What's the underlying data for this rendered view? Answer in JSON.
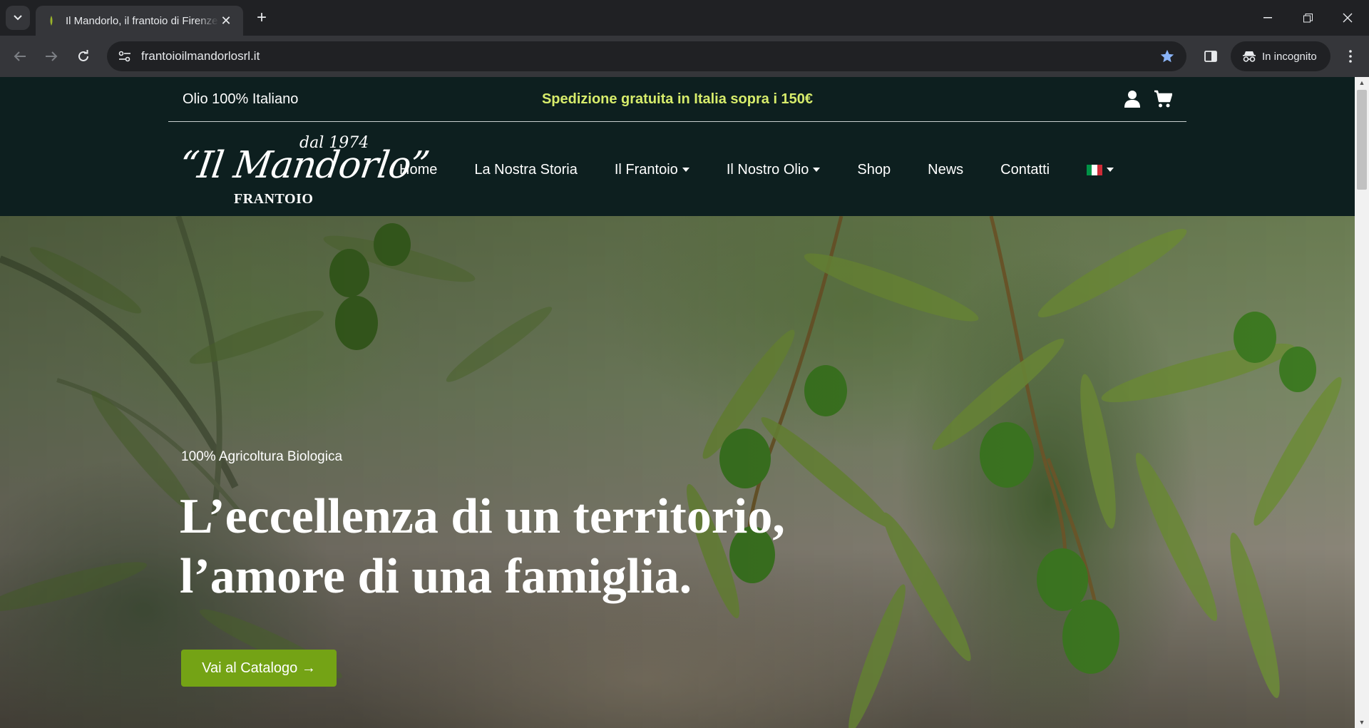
{
  "browser": {
    "tab_title": "Il Mandorlo, il frantoio di Firenze",
    "url": "frantoioilmandorlosrl.it",
    "incognito_label": "In incognito"
  },
  "topbar": {
    "left_text": "Olio 100% Italiano",
    "center_text": "Spedizione gratuita in Italia sopra i 150€"
  },
  "logo": {
    "script_text": "“Il Mandorlo”",
    "year_text": "dal 1974",
    "sub_text": "FRANTOIO"
  },
  "nav": {
    "items": [
      {
        "label": "Home",
        "dropdown": false
      },
      {
        "label": "La Nostra Storia",
        "dropdown": false
      },
      {
        "label": "Il Frantoio",
        "dropdown": true
      },
      {
        "label": "Il Nostro Olio",
        "dropdown": true
      },
      {
        "label": "Shop",
        "dropdown": false
      },
      {
        "label": "News",
        "dropdown": false
      },
      {
        "label": "Contatti",
        "dropdown": false
      }
    ],
    "language_flag_colors": [
      "#009246",
      "#ffffff",
      "#ce2b37"
    ]
  },
  "hero": {
    "eyebrow": "100% Agricoltura Biologica",
    "title_line1": "L’eccellenza di un territorio,",
    "title_line2": "l’amore di una famiglia.",
    "cta_label": "Vai al Catalogo →"
  },
  "colors": {
    "header_bg": "#0d1f1f",
    "promo_text": "#d7ec6b",
    "cta_bg": "#74a315"
  }
}
